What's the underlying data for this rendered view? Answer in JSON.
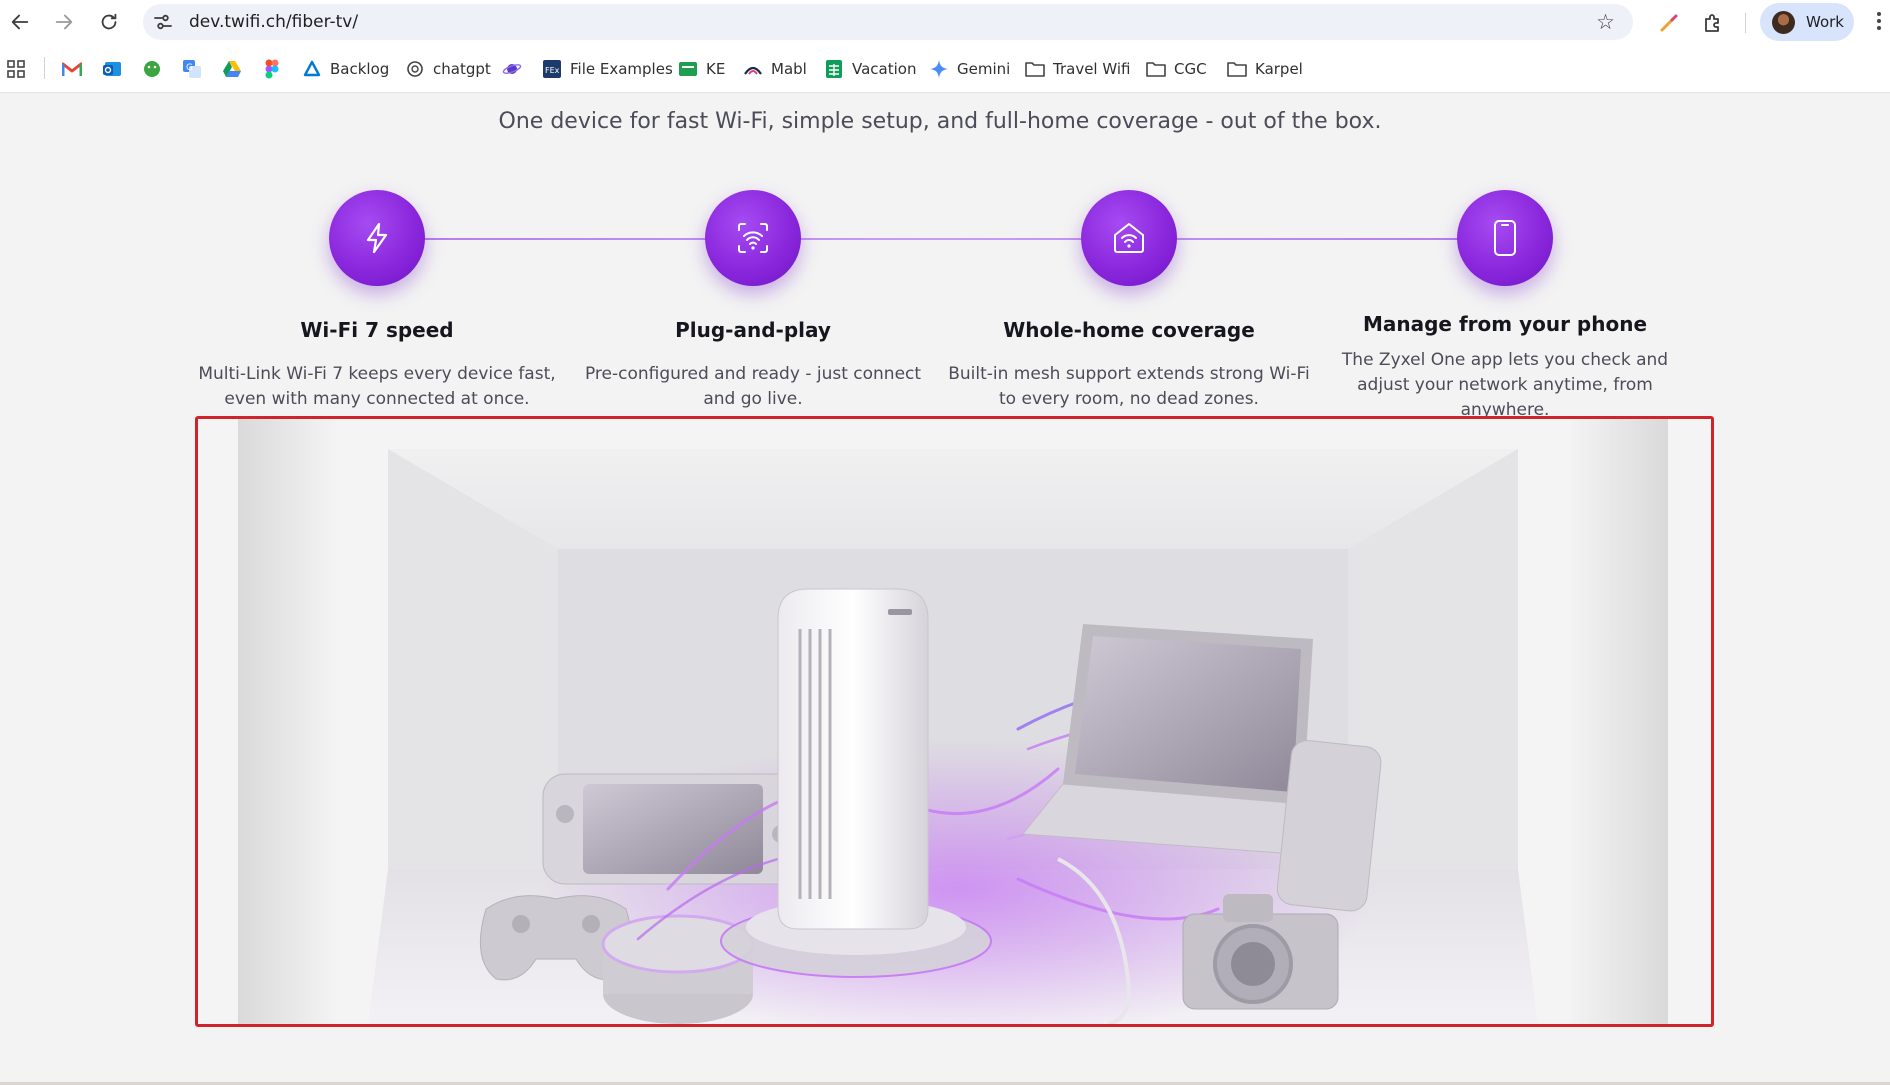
{
  "browser": {
    "url": "dev.twifi.ch/fiber-tv/",
    "profile_name": "Work",
    "bookmarks": [
      {
        "label": "",
        "icon": "apps-grid-icon"
      },
      {
        "label": "",
        "icon": "gmail-icon"
      },
      {
        "label": "",
        "icon": "outlook-icon"
      },
      {
        "label": "",
        "icon": "android-icon"
      },
      {
        "label": "",
        "icon": "translate-icon"
      },
      {
        "label": "",
        "icon": "drive-icon"
      },
      {
        "label": "",
        "icon": "figma-icon"
      },
      {
        "label": "Backlog",
        "icon": "backlog-icon"
      },
      {
        "label": "chatgpt",
        "icon": "chatgpt-icon"
      },
      {
        "label": "",
        "icon": "planet-icon"
      },
      {
        "label": "File Examples",
        "icon": "file-examples-icon"
      },
      {
        "label": "KE",
        "icon": "ke-icon"
      },
      {
        "label": "Mabl",
        "icon": "mabl-icon"
      },
      {
        "label": "Vacation",
        "icon": "sheets-icon"
      },
      {
        "label": "Gemini",
        "icon": "gemini-icon"
      },
      {
        "label": "Travel Wifi",
        "icon": "folder-icon"
      },
      {
        "label": "CGC",
        "icon": "folder-icon"
      },
      {
        "label": "Karpel",
        "icon": "folder-icon"
      }
    ]
  },
  "page": {
    "subtitle": "One device for fast Wi-Fi, simple setup, and full-home coverage - out of the box.",
    "features": [
      {
        "icon": "lightning-icon",
        "title": "Wi-Fi 7 speed",
        "description": "Multi-Link Wi-Fi 7 keeps every device fast, even with many connected at once."
      },
      {
        "icon": "plug-wifi-icon",
        "title": "Plug-and-play",
        "description": "Pre-configured and ready - just connect and go live."
      },
      {
        "icon": "home-wifi-icon",
        "title": "Whole-home coverage",
        "description": "Built-in mesh support extends strong Wi-Fi to every room, no dead zones."
      },
      {
        "icon": "phone-icon",
        "title": "Manage from your phone",
        "description": "The Zyxel One app lets you check and adjust your network anytime, from anywhere."
      }
    ],
    "hero_image": {
      "subject": "White Wi-Fi router surrounded by connected devices with purple light streams",
      "accent_color": "#c779f5",
      "highlight_border_color": "#d0242c"
    }
  },
  "colors": {
    "icon_circle": "#8a27dc",
    "timeline": "#b37bf0",
    "omnibox_bg": "#eef1f7",
    "profile_bg": "#d8e4fb"
  }
}
